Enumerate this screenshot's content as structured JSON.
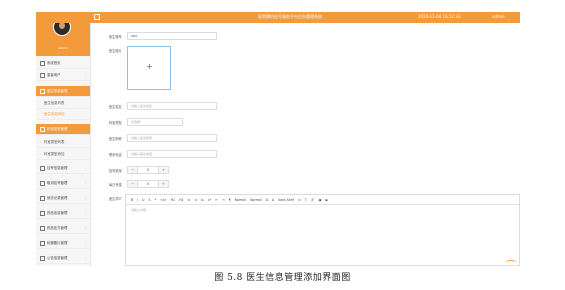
{
  "topbar": {
    "title": "医院预约挂号服务平台后台管理系统",
    "datetime": "2024-11-04 16:12:33",
    "user": "admin"
  },
  "profile": {
    "username": "admin"
  },
  "sidebar": {
    "items": [
      {
        "label": "系统首页"
      },
      {
        "label": "患者用户"
      },
      {
        "label": "医生信息管理"
      },
      {
        "label": "医生信息列表"
      },
      {
        "label": "医生信息添加"
      },
      {
        "label": "科室类型管理"
      },
      {
        "label": "科室类型列表"
      },
      {
        "label": "科室类型添加"
      },
      {
        "label": "挂号信息管理"
      },
      {
        "label": "取消挂号管理"
      },
      {
        "label": "就诊记录管理"
      },
      {
        "label": "药品信息管理"
      },
      {
        "label": "药品处方管理"
      },
      {
        "label": "轮播图片管理"
      },
      {
        "label": "公告信息管理"
      }
    ]
  },
  "form": {
    "doctor_account": {
      "label": "医生账号",
      "value": "XXX"
    },
    "doctor_photo": {
      "label": "医生照片",
      "plus": "+"
    },
    "doctor_name": {
      "label": "医生姓名",
      "placeholder": "请输入医生姓名"
    },
    "dept_type": {
      "label": "科室类型",
      "placeholder": "请选择"
    },
    "doctor_title": {
      "label": "医生职称",
      "placeholder": "请输入医生职称"
    },
    "contact_phone": {
      "label": "联系电话",
      "placeholder": "请输入联系电话"
    },
    "reg_fee": {
      "label": "挂号费用",
      "value": "0"
    },
    "daily_limit": {
      "label": "每日号源",
      "value": "0"
    },
    "intro": {
      "label": "医生简介",
      "placeholder": "请输入内容..."
    }
  },
  "editor_toolbar": [
    "B",
    "I",
    "U",
    "S",
    "❝",
    "</>",
    "H1",
    "H2",
    "≡",
    "≡",
    "x₂",
    "x²",
    "⇤",
    "⇥",
    "¶",
    "Normal",
    "Normal",
    "A",
    "A",
    "Sans Serif",
    "≡",
    "T",
    "🔗",
    "▣",
    "▶"
  ],
  "caption": "图 5.8    医生信息管理添加界面图"
}
